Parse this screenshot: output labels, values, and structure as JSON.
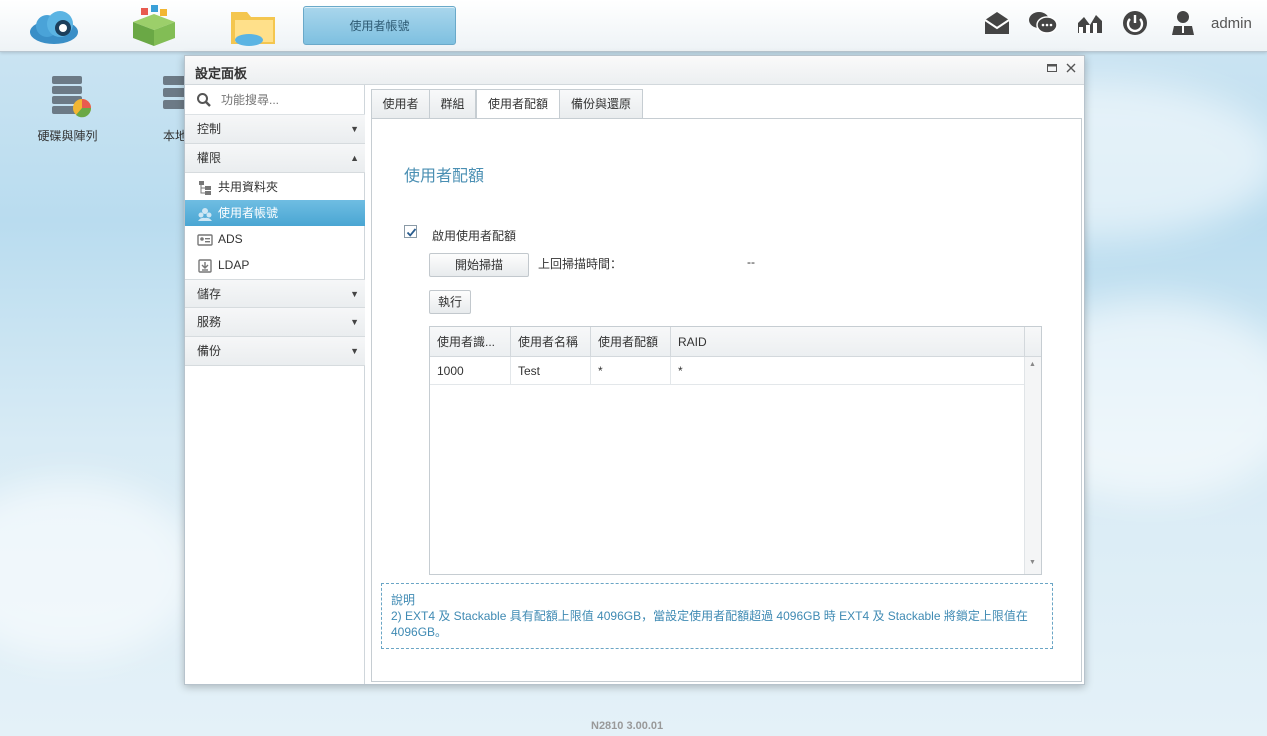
{
  "taskbar": {
    "active_window_label": "使用者帳號",
    "user_label": "admin"
  },
  "desktop": {
    "icons": [
      {
        "label": "硬碟與陣列"
      },
      {
        "label": "本地"
      }
    ],
    "footer_version": "N2810   3.00.01"
  },
  "window": {
    "title": "設定面板"
  },
  "sidebar": {
    "search_placeholder": "功能搜尋...",
    "sections": {
      "control": "控制",
      "permissions": "權限",
      "storage": "儲存",
      "service": "服務",
      "backup": "備份"
    },
    "items": [
      {
        "label": "共用資料夾"
      },
      {
        "label": "使用者帳號"
      },
      {
        "label": "ADS"
      },
      {
        "label": "LDAP"
      }
    ]
  },
  "tabs": [
    {
      "label": "使用者"
    },
    {
      "label": "群組"
    },
    {
      "label": "使用者配額"
    },
    {
      "label": "備份與還原"
    }
  ],
  "quota": {
    "title": "使用者配額",
    "enable_label": "啟用使用者配額",
    "enable_checked": true,
    "scan_button": "開始掃描",
    "last_scan_label": "上回掃描時間：",
    "last_scan_value": "--",
    "run_button": "執行",
    "columns": [
      "使用者識...",
      "使用者名稱",
      "使用者配額",
      "RAID"
    ],
    "rows": [
      [
        "1000",
        "Test",
        "*",
        "*"
      ]
    ],
    "note_title": "說明",
    "note_text": "2) EXT4 及 Stackable 具有配額上限值 4096GB，當設定使用者配額超過 4096GB 時 EXT4 及 Stackable 將鎖定上限值在 4096GB。"
  },
  "colors": {
    "accent": "#4aa6d3",
    "title_blue": "#4a8fb3",
    "note_blue": "#3f8ab3"
  }
}
